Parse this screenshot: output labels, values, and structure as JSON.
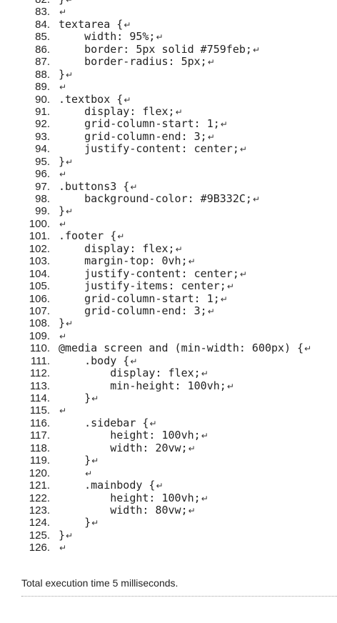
{
  "return_glyph": "↵",
  "lines": [
    {
      "num": "82.",
      "code": "}"
    },
    {
      "num": "83.",
      "code": ""
    },
    {
      "num": "84.",
      "code": "textarea {"
    },
    {
      "num": "85.",
      "code": "    width: 95%;"
    },
    {
      "num": "86.",
      "code": "    border: 5px solid #759feb;"
    },
    {
      "num": "87.",
      "code": "    border-radius: 5px;"
    },
    {
      "num": "88.",
      "code": "}"
    },
    {
      "num": "89.",
      "code": ""
    },
    {
      "num": "90.",
      "code": ".textbox {"
    },
    {
      "num": "91.",
      "code": "    display: flex;"
    },
    {
      "num": "92.",
      "code": "    grid-column-start: 1;"
    },
    {
      "num": "93.",
      "code": "    grid-column-end: 3;"
    },
    {
      "num": "94.",
      "code": "    justify-content: center;"
    },
    {
      "num": "95.",
      "code": "}"
    },
    {
      "num": "96.",
      "code": ""
    },
    {
      "num": "97.",
      "code": ".buttons3 {"
    },
    {
      "num": "98.",
      "code": "    background-color: #9B332C;"
    },
    {
      "num": "99.",
      "code": "}"
    },
    {
      "num": "100.",
      "code": ""
    },
    {
      "num": "101.",
      "code": ".footer {"
    },
    {
      "num": "102.",
      "code": "    display: flex;"
    },
    {
      "num": "103.",
      "code": "    margin-top: 0vh;"
    },
    {
      "num": "104.",
      "code": "    justify-content: center;"
    },
    {
      "num": "105.",
      "code": "    justify-items: center;"
    },
    {
      "num": "106.",
      "code": "    grid-column-start: 1;"
    },
    {
      "num": "107.",
      "code": "    grid-column-end: 3;"
    },
    {
      "num": "108.",
      "code": "}"
    },
    {
      "num": "109.",
      "code": ""
    },
    {
      "num": "110.",
      "code": "@media screen and (min-width: 600px) {"
    },
    {
      "num": "111.",
      "code": "    .body {"
    },
    {
      "num": "112.",
      "code": "        display: flex;"
    },
    {
      "num": "113.",
      "code": "        min-height: 100vh;"
    },
    {
      "num": "114.",
      "code": "    }"
    },
    {
      "num": "115.",
      "code": ""
    },
    {
      "num": "116.",
      "code": "    .sidebar {"
    },
    {
      "num": "117.",
      "code": "        height: 100vh;"
    },
    {
      "num": "118.",
      "code": "        width: 20vw;"
    },
    {
      "num": "119.",
      "code": "    }"
    },
    {
      "num": "120.",
      "code": "    "
    },
    {
      "num": "121.",
      "code": "    .mainbody {"
    },
    {
      "num": "122.",
      "code": "        height: 100vh;"
    },
    {
      "num": "123.",
      "code": "        width: 80vw;"
    },
    {
      "num": "124.",
      "code": "    }"
    },
    {
      "num": "125.",
      "code": "}"
    },
    {
      "num": "126.",
      "code": ""
    }
  ],
  "footer": {
    "execution_time": "Total execution time 5 milliseconds."
  }
}
